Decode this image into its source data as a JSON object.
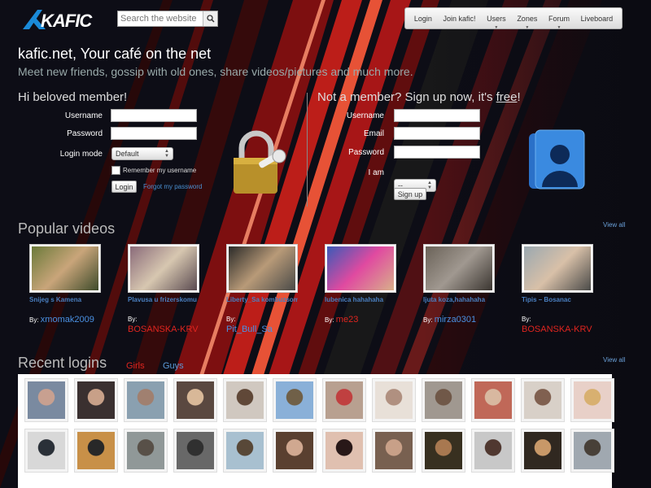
{
  "header": {
    "logo_text": "KAFIC",
    "search_placeholder": "Search the website",
    "nav": [
      {
        "label": "Login",
        "dropdown": false
      },
      {
        "label": "Join kafic!",
        "dropdown": false
      },
      {
        "label": "Users",
        "dropdown": true
      },
      {
        "label": "Zones",
        "dropdown": true
      },
      {
        "label": "Forum",
        "dropdown": true
      },
      {
        "label": "Liveboard",
        "dropdown": false
      }
    ]
  },
  "intro": {
    "title": "kafic.net, Your café on the net",
    "tagline": "Meet new friends, gossip with old ones, share videos/pictures and much more."
  },
  "login": {
    "heading": "Hi beloved member!",
    "username_label": "Username",
    "password_label": "Password",
    "mode_label": "Login mode",
    "mode_value": "Default",
    "remember_label": "Remember my username",
    "submit_label": "Login",
    "forgot_label": "Forgot my password"
  },
  "signup": {
    "heading_prefix": "Not a member? Sign up now, it's ",
    "heading_free": "free",
    "heading_suffix": "!",
    "username_label": "Username",
    "email_label": "Email",
    "password_label": "Password",
    "iam_label": "I am",
    "iam_value": "--",
    "submit_label": "Sign up"
  },
  "videos": {
    "title": "Popular videos",
    "view_all": "View all",
    "items": [
      {
        "title": "Snijeg s Kamena",
        "by": "By:",
        "user": "xmomak2009",
        "user_color": "#4a90e2",
        "thumb": [
          "#6b7a3a",
          "#c9a57a",
          "#3d4a2a"
        ]
      },
      {
        "title": "Plavusa u frizerskomu",
        "by": "By:",
        "user": "BOSANSKA-KRV",
        "user_color": "#e0251f",
        "thumb": [
          "#8a6b7a",
          "#d7c7b0",
          "#5a4a50"
        ]
      },
      {
        "title": "Liberty_Sa kombuzsom!!!",
        "by": "By:",
        "user": "Pit_Bull_Sa",
        "user_color": "#4a90e2",
        "thumb": [
          "#2a2a28",
          "#b89a78",
          "#4a4a48"
        ]
      },
      {
        "title": "lubenica hahahaha",
        "by": "By:",
        "user": "me23",
        "user_color": "#e0251f",
        "thumb": [
          "#3a5ab8",
          "#e04aa0",
          "#d8b08a"
        ]
      },
      {
        "title": "ljuta koza,hahahaha",
        "by": "By:",
        "user": "mirza0301",
        "user_color": "#4a90e2",
        "thumb": [
          "#6a6258",
          "#a09890",
          "#3a3530"
        ]
      },
      {
        "title": "Tipis – Bosanac",
        "by": "By:",
        "user": "BOSANSKA-KRV",
        "user_color": "#e0251f",
        "thumb": [
          "#9aa8b0",
          "#d8c0a8",
          "#4a4a48"
        ]
      }
    ]
  },
  "logins": {
    "title": "Recent logins",
    "view_all": "View all",
    "tab_girls": "Girls",
    "tab_guys": "Guys",
    "avatars": [
      [
        "#7a8aa0",
        "#c8a090"
      ],
      [
        "#3a3030",
        "#c8a088"
      ],
      [
        "#8aa0b0",
        "#a08070"
      ],
      [
        "#5a4840",
        "#d8b898"
      ],
      [
        "#d0c8c0",
        "#604838"
      ],
      [
        "#8ab0d8",
        "#706048"
      ],
      [
        "#b8a090",
        "#c04040"
      ],
      [
        "#e8e0d8",
        "#b09080"
      ],
      [
        "#a09890",
        "#705848"
      ],
      [
        "#c06858",
        "#d8b8a0"
      ],
      [
        "#d8d0c8",
        "#806050"
      ],
      [
        "#e8d0c8",
        "#d8b070"
      ],
      [
        "#d8d8d8",
        "#2a3038"
      ],
      [
        "#c89048",
        "#282828"
      ],
      [
        "#909898",
        "#585048"
      ],
      [
        "#686868",
        "#303030"
      ],
      [
        "#a8c0d0",
        "#584838"
      ],
      [
        "#5a4030",
        "#d0a890"
      ],
      [
        "#e0c0b0",
        "#281818"
      ],
      [
        "#786050",
        "#c8a088"
      ],
      [
        "#383020",
        "#a87850"
      ],
      [
        "#c8c8c8",
        "#503830"
      ],
      [
        "#302820",
        "#c89868"
      ],
      [
        "#a0a8b0",
        "#484038"
      ]
    ]
  }
}
